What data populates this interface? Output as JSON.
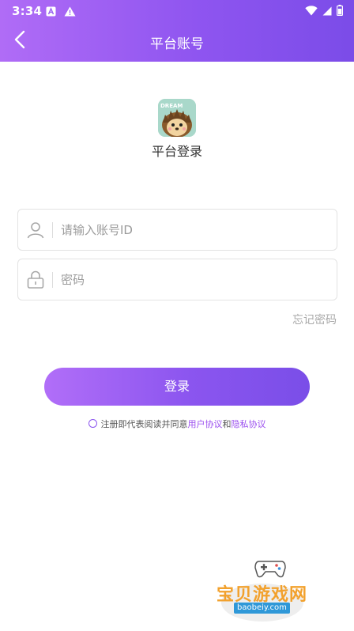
{
  "status_bar": {
    "time": "3:34",
    "left_icons": [
      "notification-a-icon",
      "warning-icon"
    ],
    "right_icons": [
      "wifi-icon",
      "signal-icon",
      "battery-icon"
    ]
  },
  "nav": {
    "title": "平台账号",
    "back_icon": "chevron-left-icon"
  },
  "brand": {
    "logo_text": "DREAM",
    "subtitle": "平台登录"
  },
  "form": {
    "account_placeholder": "请输入账号ID",
    "account_value": "",
    "account_icon": "user-icon",
    "password_placeholder": "密码",
    "password_value": "",
    "password_icon": "lock-icon",
    "forgot_label": "忘记密码",
    "login_label": "登录"
  },
  "agreement": {
    "prefix": "注册即代表阅读并同意",
    "user_agreement": "用户协议",
    "and": "和",
    "privacy_policy": "隐私协议"
  },
  "watermark": {
    "text": "宝贝游戏网",
    "url": "baobeiy.com"
  },
  "colors": {
    "accent_start": "#b06cf6",
    "accent_end": "#7b4ce8",
    "link": "#9b4fef"
  }
}
